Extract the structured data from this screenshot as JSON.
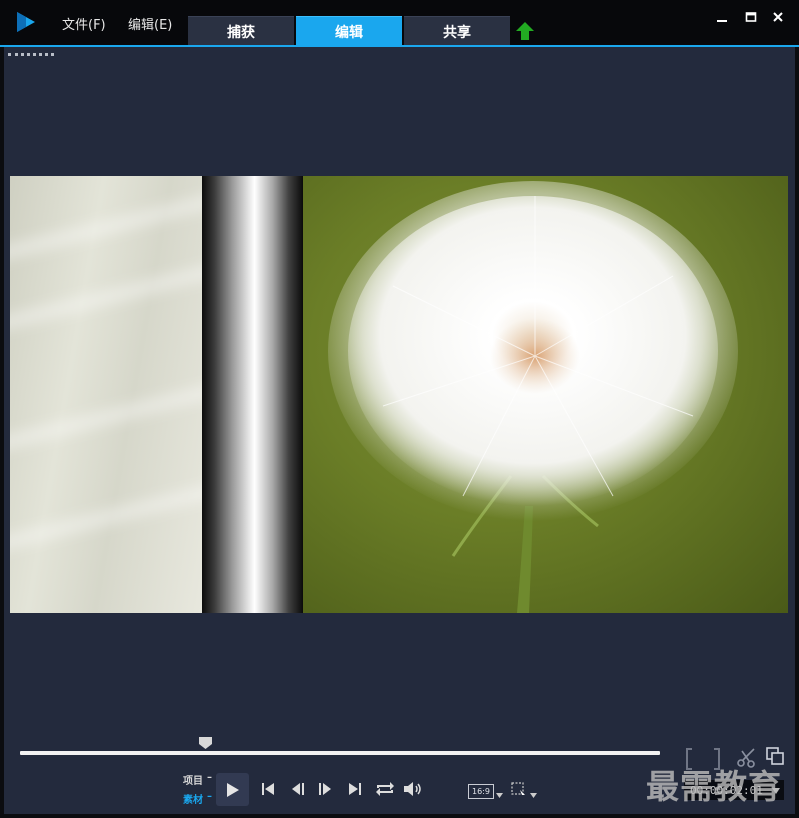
{
  "menu": {
    "file": "文件(F)",
    "edit": "编辑(E)"
  },
  "tabs": [
    {
      "label": "捕获",
      "active": false
    },
    {
      "label": "编辑",
      "active": true
    },
    {
      "label": "共享",
      "active": false
    }
  ],
  "player": {
    "project_label": "项目",
    "clip_label": "素材",
    "aspect_ratio": "16:9",
    "timecode": "00:00:02:01",
    "scrubber_position": 0.29
  },
  "watermark": "最需教育",
  "colors": {
    "accent": "#1aa7ee",
    "panel": "#232a3d",
    "titlebar": "#07080b",
    "upload": "#22aa22"
  },
  "icons": [
    "app-logo-icon",
    "upload-icon",
    "minimize-icon",
    "maximize-icon",
    "close-icon",
    "play-icon",
    "prev-icon",
    "step-back-icon",
    "step-forward-icon",
    "next-icon",
    "repeat-icon",
    "volume-icon",
    "dropdown-icon",
    "crop-icon",
    "mark-in-icon",
    "scissors-icon",
    "copy-icon"
  ]
}
